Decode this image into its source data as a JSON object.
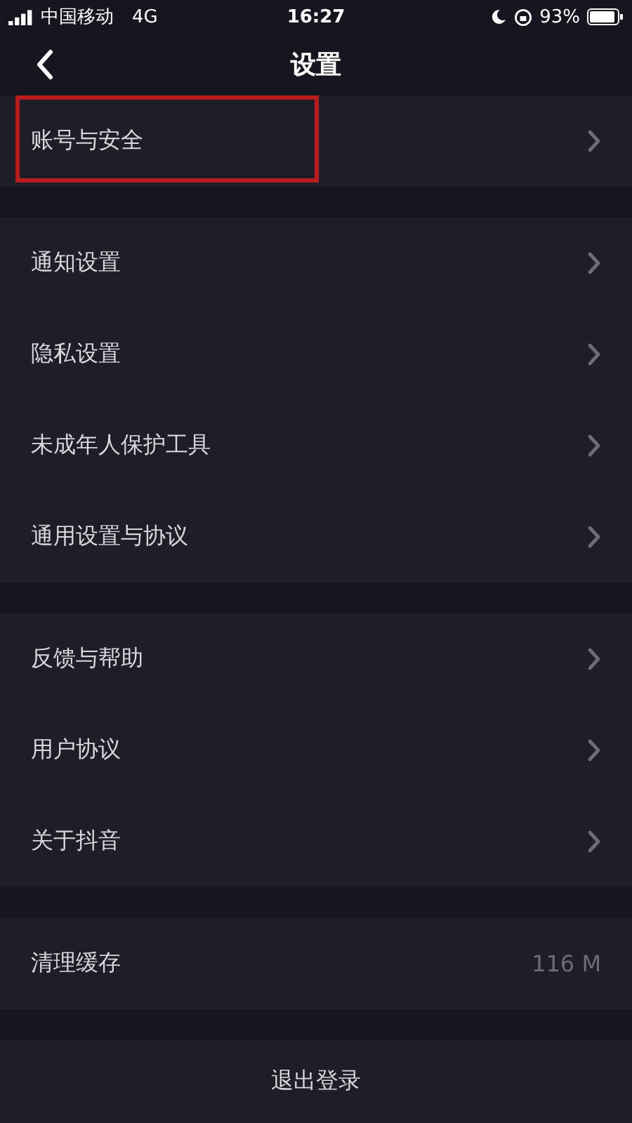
{
  "status_bar": {
    "carrier": "中国移动",
    "network": "4G",
    "time": "16:27",
    "battery": "93%"
  },
  "nav": {
    "title": "设置"
  },
  "groups": [
    {
      "items": [
        {
          "label": "账号与安全",
          "highlighted": true
        }
      ]
    },
    {
      "items": [
        {
          "label": "通知设置",
          "highlighted": false
        },
        {
          "label": "隐私设置",
          "highlighted": false
        },
        {
          "label": "未成年人保护工具",
          "highlighted": false
        },
        {
          "label": "通用设置与协议",
          "highlighted": false
        }
      ]
    },
    {
      "items": [
        {
          "label": "反馈与帮助",
          "highlighted": false
        },
        {
          "label": "用户协议",
          "highlighted": false
        },
        {
          "label": "关于抖音",
          "highlighted": false
        }
      ]
    },
    {
      "items": [
        {
          "label": "清理缓存",
          "value": "116 M",
          "highlighted": false
        }
      ]
    }
  ],
  "logout": "退出登录"
}
